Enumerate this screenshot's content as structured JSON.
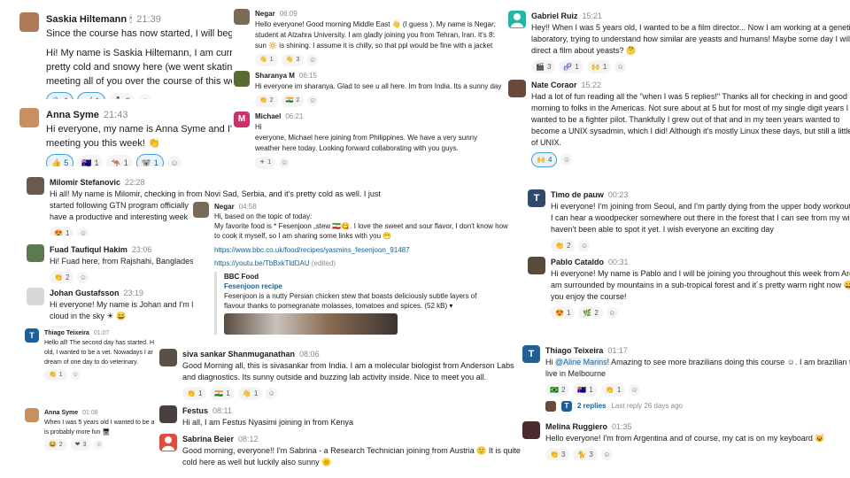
{
  "messages": [
    {
      "id": "saskia",
      "name": "Saskia Hiltemann",
      "name_suffix": "🕯",
      "time": "21:39",
      "lines": [
        "Since the course has now started, I will begin w",
        "Hi! My name is Saskia Hiltemann, I am currently",
        "pretty cold and snowy here (we went skating o",
        "meeting all of you over the course of this week"
      ],
      "reactions": [
        {
          "emoji": "⛸",
          "count": "1",
          "selected": true
        },
        {
          "emoji": "🏒",
          "count": "1",
          "selected": true
        },
        {
          "emoji": "⛄",
          "count": "2",
          "selected": false
        }
      ],
      "avatar": {
        "type": "photo",
        "bg": "#b07a5a"
      }
    },
    {
      "id": "anna1",
      "name": "Anna Syme",
      "time": "21:43",
      "lines": [
        "Hi everyone, my name is Anna Syme and I'm in",
        "meeting you this week! 👏"
      ],
      "reactions": [
        {
          "emoji": "👍",
          "count": "5",
          "selected": true
        },
        {
          "emoji": "🇦🇺",
          "count": "1",
          "selected": false
        },
        {
          "emoji": "🦘",
          "count": "1",
          "selected": false
        },
        {
          "emoji": "🐨",
          "count": "1",
          "selected": true
        }
      ],
      "avatar": {
        "type": "photo",
        "bg": "#c89060"
      }
    },
    {
      "id": "milomir",
      "name": "Milomir Stefanovic",
      "time": "22:28",
      "lines": [
        "Hi all! My name is Milomir, checking in from Novi Sad, Serbia, and it's pretty cold as well. I just",
        "started following GTN program officially",
        "have a productive and interesting week"
      ],
      "reactions": [
        {
          "emoji": "😍",
          "count": "1",
          "selected": false
        }
      ],
      "avatar": {
        "type": "photo",
        "bg": "#6a5a50"
      }
    },
    {
      "id": "fuad",
      "name": "Fuad Taufiqul Hakim",
      "time": "23:06",
      "lines": [
        "Hi! Fuad here, from Rajshahi, Bangladesl"
      ],
      "reactions": [
        {
          "emoji": "👏",
          "count": "2",
          "selected": false
        }
      ],
      "avatar": {
        "type": "photo",
        "bg": "#5a7a50"
      }
    },
    {
      "id": "johan",
      "name": "Johan Gustafsson",
      "time": "23:19",
      "lines": [
        "Hi everyone! My name is Johan and I'm l",
        "cloud in the sky ☀ 😄"
      ],
      "reactions": [
        {
          "emoji": "🦌",
          "count": "1",
          "selected": false
        }
      ],
      "avatar": {
        "type": "photo",
        "bg": "#d8d8d8"
      }
    },
    {
      "id": "thiago1",
      "name": "Thiago Teixeira",
      "time": "01:07",
      "lines": [
        "Hello all! The second day has started. H",
        "old, I wanted to be a vet. Nowadays I ar",
        "dream of one day to do veterinary."
      ],
      "reactions": [
        {
          "emoji": "👏",
          "count": "1",
          "selected": false
        }
      ],
      "avatar": {
        "type": "initial",
        "letter": "T",
        "bg": "#1d5f96"
      }
    },
    {
      "id": "anna2",
      "name": "Anna Syme",
      "time": "01:08",
      "lines": [
        "When I was 5 years old I wanted to be a",
        "is probably more fun 🖥"
      ],
      "reactions": [
        {
          "emoji": "😂",
          "count": "2",
          "selected": false
        },
        {
          "emoji": "❤",
          "count": "3",
          "selected": false
        }
      ],
      "avatar": {
        "type": "photo",
        "bg": "#c89060"
      }
    },
    {
      "id": "negar1",
      "name": "Negar",
      "time": "06:09",
      "lines": [
        "Hello everyone! Good morning Middle East 👋 (I guess ). My name is Negar;",
        "student at Alzahra University. I am gladly joining you from Tehran, Iran. It's 8:",
        "sun 🔆 is shining.  I assume it is chilly, so that ppl would be fine with a jacket"
      ],
      "reactions": [
        {
          "emoji": "👋",
          "count": "1",
          "selected": false
        },
        {
          "emoji": "👋",
          "count": "3",
          "selected": false
        }
      ],
      "avatar": {
        "type": "photo",
        "bg": "#7a6a58"
      }
    },
    {
      "id": "sharanya",
      "name": "Sharanya M",
      "time": "06:15",
      "lines": [
        "Hi everyone im sharanya. Glad to see u all here. Im from India. Its a sunny day"
      ],
      "reactions": [
        {
          "emoji": "👏",
          "count": "2",
          "selected": false
        },
        {
          "emoji": "🇮🇳",
          "count": "2",
          "selected": false
        }
      ],
      "avatar": {
        "type": "photo",
        "bg": "#5a6a30"
      }
    },
    {
      "id": "michael",
      "name": "Michael",
      "time": "06:21",
      "lines": [
        "Hi",
        "everyone, Michael here joining from Philippines. We have a very sunny",
        "weather here today. Looking forward collaborating with you guys."
      ],
      "reactions": [
        {
          "emoji": "☀",
          "count": "1",
          "selected": false
        }
      ],
      "avatar": {
        "type": "initial",
        "letter": "M",
        "bg": "#d0306a"
      }
    },
    {
      "id": "negar2",
      "name": "Negar",
      "time": "04:58",
      "lines": [
        "Hi, based on the topic of today:",
        "My favorite food is * Fesenjoon „stew 🇮🇷😋. I love the sweet and sour flavor, I don't know how",
        "to cook it myself, so I am sharing some links with you 😁"
      ],
      "link1": "https://www.bbc.co.uk/food/recipes/yasmins_fesenjoon_91487",
      "link2": "https://youtu.be/TbBxkTldDAU",
      "edited": "(edited)",
      "preview": {
        "site": "BBC Food",
        "title": "Fesenjoon recipe",
        "desc1": "Fesenjoon is a nutty Persian chicken stew that boasts deliciously subtle layers of",
        "desc2": "flavour thanks to pomegranate molasses, tomatoes and spices. (52 kB) ▾"
      },
      "avatar": {
        "type": "photo",
        "bg": "#7a6a58"
      }
    },
    {
      "id": "siva",
      "name": "siva sankar Shanmuganathan",
      "time": "08:06",
      "lines": [
        "Good Morning all, this is sivasankar from India. I am a molecular biologist from Anderson Labs",
        "and diagnostics. Its sunny outside and buzzing lab activity inside. Nice to meet you all."
      ],
      "reactions": [
        {
          "emoji": "👏",
          "count": "1",
          "selected": false
        },
        {
          "emoji": "🇮🇳",
          "count": "1",
          "selected": false
        },
        {
          "emoji": "👋",
          "count": "1",
          "selected": false
        }
      ],
      "avatar": {
        "type": "photo",
        "bg": "#5a5048"
      }
    },
    {
      "id": "festus",
      "name": "Festus",
      "time": "08:11",
      "lines": [
        "Hi all, I am Festus Nyasimi joining in from Kenya"
      ],
      "reactions": [],
      "avatar": {
        "type": "photo",
        "bg": "#4a4040"
      }
    },
    {
      "id": "sabrina",
      "name": "Sabrina Beier",
      "time": "08:12",
      "lines": [
        "Good morning, everyone!! I'm Sabrina - a Research Technician joining from Austria 🙂 It is quite",
        "cold here as well but luckily also sunny 🌞"
      ],
      "reactions": [],
      "avatar": {
        "type": "person",
        "bg": "#e24a3a"
      }
    },
    {
      "id": "gabriel",
      "name": "Gabriel Ruiz",
      "time": "15:21",
      "lines": [
        "Hey!! When I was 5 years old, I wanted to be a film director... Now I am working at a genetic",
        "laboratory, trying to understand how similar are yeasts and humans! Maybe some day I will",
        "direct a film about yeasts? 🤔"
      ],
      "reactions": [
        {
          "emoji": "🎬",
          "count": "3",
          "selected": false
        },
        {
          "emoji": "🧬",
          "count": "1",
          "selected": false
        },
        {
          "emoji": "🙌",
          "count": "1",
          "selected": false
        }
      ],
      "avatar": {
        "type": "person",
        "bg": "#1fb8a6"
      }
    },
    {
      "id": "nate",
      "name": "Nate Coraor",
      "time": "15:22",
      "lines": [
        "Had a lot of fun reading all the \"when I was 5 replies!\" Thanks all for checking in and good",
        "morning to folks in the Americas. Not sure about at 5 but for most of my single digit years I",
        "wanted to be a fighter pilot. Thankfully I grew out of that and in my teen years wanted to",
        "become a UNIX sysadmin, which I did! Although it's mostly Linux these days, but still a little",
        "of UNIX."
      ],
      "reactions": [
        {
          "emoji": "🙌",
          "count": "4",
          "selected": true
        }
      ],
      "avatar": {
        "type": "photo",
        "bg": "#6a4a3a"
      }
    },
    {
      "id": "timo",
      "name": "Timo de pauw",
      "time": "00:23",
      "lines": [
        "Hi everyone! I'm joining from Seoul, and I'm partly dying from the upper body workout",
        "I can hear a woodpecker somewhere out there in the forest that I can see from my wind",
        "haven't been able to spot it yet. I wish everyone an exciting day"
      ],
      "reactions": [
        {
          "emoji": "👏",
          "count": "2",
          "selected": false
        }
      ],
      "avatar": {
        "type": "initial",
        "letter": "T",
        "bg": "#2f4a6a"
      }
    },
    {
      "id": "pablo",
      "name": "Pablo Cataldo",
      "time": "00:31",
      "lines": [
        "Hi everyone! My name is Pablo and I will be joining you throughout this week from Arg",
        "am surrounded by mountains in a sub-tropical forest and  it´s pretty warm right now 😄",
        "you enjoy the course!"
      ],
      "reactions": [
        {
          "emoji": "😍",
          "count": "1",
          "selected": false
        },
        {
          "emoji": "🌿",
          "count": "2",
          "selected": false
        }
      ],
      "avatar": {
        "type": "photo",
        "bg": "#5a4a3a"
      }
    },
    {
      "id": "thiago2",
      "name": "Thiago Teixeira",
      "time": "01:17",
      "lines_rich": true,
      "pre": "Hi ",
      "mention": "@Aline Marins",
      "post": "! Amazing to see more brazilians doing this course ☺. I am brazilian to",
      "line2": "live in Melbourne",
      "reactions": [
        {
          "emoji": "🇧🇷",
          "count": "2",
          "selected": false
        },
        {
          "emoji": "🇦🇺",
          "count": "1",
          "selected": false
        },
        {
          "emoji": "👏",
          "count": "1",
          "selected": false
        }
      ],
      "replies": "2 replies",
      "last_reply": "Last reply 26 days ago",
      "avatar": {
        "type": "initial",
        "letter": "T",
        "bg": "#1d5f96"
      }
    },
    {
      "id": "melina",
      "name": "Melina Ruggiero",
      "time": "01:35",
      "lines": [
        "Hello everyone! I'm from Argentina and of course, my cat is on my keyboard 😺"
      ],
      "reactions": [
        {
          "emoji": "👏",
          "count": "3",
          "selected": false
        },
        {
          "emoji": "🐈",
          "count": "3",
          "selected": false
        }
      ],
      "avatar": {
        "type": "photo",
        "bg": "#4a2a2a"
      }
    }
  ],
  "colors": {
    "link": "#1264a3",
    "selected_reaction_border": "#4a9fd8",
    "muted": "#8a8a8a"
  }
}
